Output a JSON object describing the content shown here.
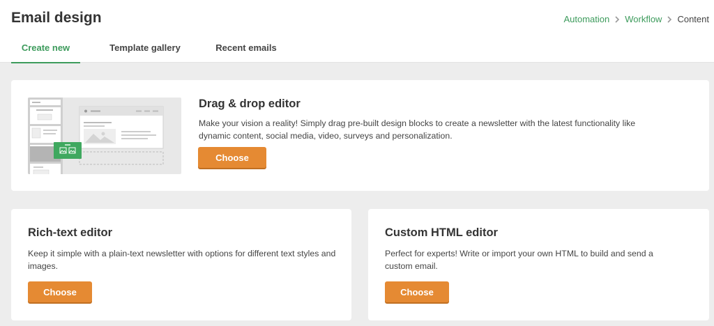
{
  "header": {
    "title": "Email design",
    "breadcrumb": [
      {
        "label": "Automation"
      },
      {
        "label": "Workflow"
      },
      {
        "label": "Content"
      }
    ]
  },
  "tabs": [
    {
      "label": "Create new",
      "active": true
    },
    {
      "label": "Template gallery",
      "active": false
    },
    {
      "label": "Recent emails",
      "active": false
    }
  ],
  "cards": {
    "drag_drop": {
      "title": "Drag & drop editor",
      "description": "Make your vision a reality! Simply drag pre-built design blocks to create a newsletter with the latest functionality like dynamic content, social media, video, surveys and personalization.",
      "button": "Choose"
    },
    "rich_text": {
      "title": "Rich-text editor",
      "description": "Keep it simple with a plain-text newsletter with options for different text styles and images.",
      "button": "Choose"
    },
    "custom_html": {
      "title": "Custom HTML editor",
      "description": "Perfect for experts! Write or import your own HTML to build and send a custom email.",
      "button": "Choose"
    }
  },
  "colors": {
    "accent_green": "#3d9b5c",
    "button_orange": "#e58a33",
    "page_background": "#ededed"
  },
  "icons": [
    "chevron-right-icon",
    "image-block-icon"
  ]
}
